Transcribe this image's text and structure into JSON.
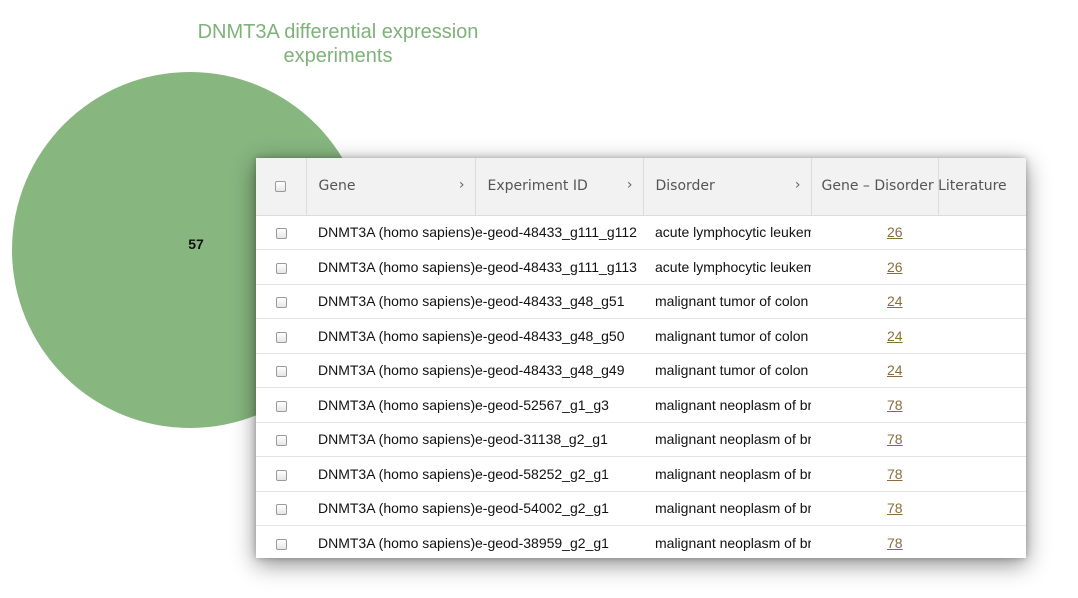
{
  "venn": {
    "title_line1": "DNMT3A differential expression",
    "title_line2": "experiments",
    "count": "57",
    "circle_color": "#87b67f",
    "title_color": "#7fb27a"
  },
  "table": {
    "headers": {
      "gene": "Gene",
      "experiment_id": "Experiment ID",
      "disorder": "Disorder",
      "literature": "Gene – Disorder Literature"
    },
    "sort_icon": "›",
    "rows": [
      {
        "gene": "DNMT3A (homo sapiens)",
        "experiment_id": "e-geod-48433_g111_g112",
        "disorder": "acute lymphocytic leukemia",
        "literature": "26"
      },
      {
        "gene": "DNMT3A (homo sapiens)",
        "experiment_id": "e-geod-48433_g111_g113",
        "disorder": "acute lymphocytic leukemia",
        "literature": "26"
      },
      {
        "gene": "DNMT3A (homo sapiens)",
        "experiment_id": "e-geod-48433_g48_g51",
        "disorder": "malignant tumor of colon",
        "literature": "24"
      },
      {
        "gene": "DNMT3A (homo sapiens)",
        "experiment_id": "e-geod-48433_g48_g50",
        "disorder": "malignant tumor of colon",
        "literature": "24"
      },
      {
        "gene": "DNMT3A (homo sapiens)",
        "experiment_id": "e-geod-48433_g48_g49",
        "disorder": "malignant tumor of colon",
        "literature": "24"
      },
      {
        "gene": "DNMT3A (homo sapiens)",
        "experiment_id": "e-geod-52567_g1_g3",
        "disorder": "malignant neoplasm of breast",
        "literature": "78"
      },
      {
        "gene": "DNMT3A (homo sapiens)",
        "experiment_id": "e-geod-31138_g2_g1",
        "disorder": "malignant neoplasm of breast",
        "literature": "78"
      },
      {
        "gene": "DNMT3A (homo sapiens)",
        "experiment_id": "e-geod-58252_g2_g1",
        "disorder": "malignant neoplasm of breast",
        "literature": "78"
      },
      {
        "gene": "DNMT3A (homo sapiens)",
        "experiment_id": "e-geod-54002_g2_g1",
        "disorder": "malignant neoplasm of breast",
        "literature": "78"
      },
      {
        "gene": "DNMT3A (homo sapiens)",
        "experiment_id": "e-geod-38959_g2_g1",
        "disorder": "malignant neoplasm of breast",
        "literature": "78"
      }
    ]
  }
}
